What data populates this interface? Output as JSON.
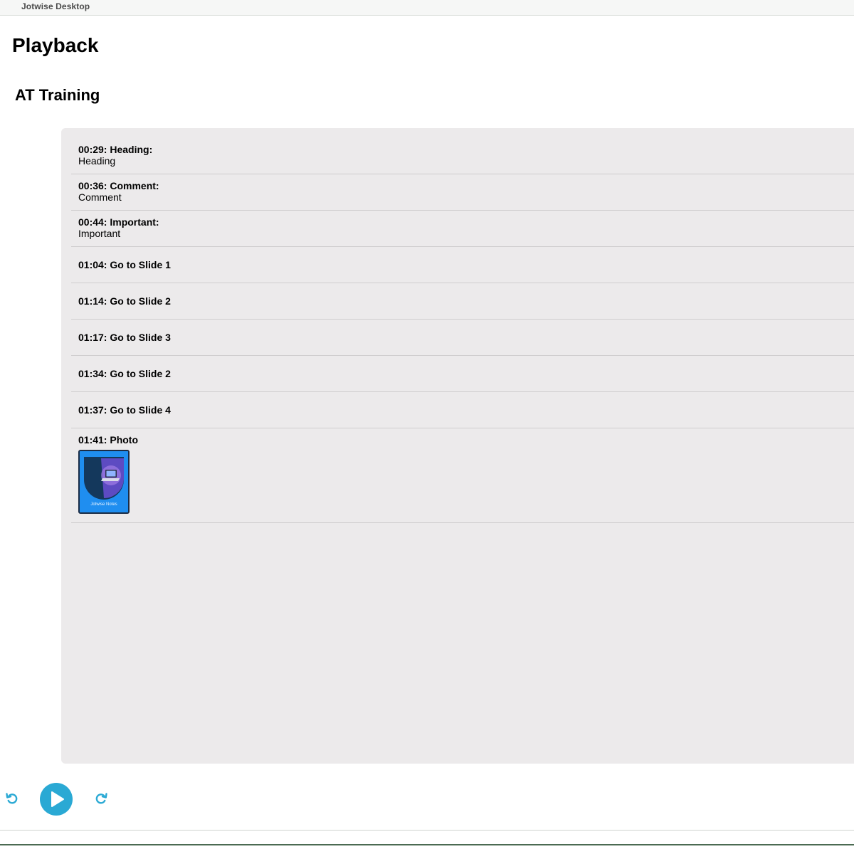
{
  "window": {
    "app_title": "Jotwise Desktop"
  },
  "page": {
    "title": "Playback",
    "recording_title": "AT Training"
  },
  "events": [
    {
      "title": "00:29: Heading:",
      "body": "Heading"
    },
    {
      "title": "00:36: Comment:",
      "body": "Comment"
    },
    {
      "title": "00:44: Important:",
      "body": "Important"
    },
    {
      "title": "01:04: Go to Slide 1",
      "body": ""
    },
    {
      "title": "01:14: Go to Slide 2",
      "body": ""
    },
    {
      "title": "01:17: Go to Slide 3",
      "body": ""
    },
    {
      "title": "01:34: Go to Slide 2",
      "body": ""
    },
    {
      "title": "01:37: Go to Slide 4",
      "body": ""
    },
    {
      "title": "01:41: Photo",
      "body": "",
      "photo_caption": "Jotwise Notes"
    }
  ],
  "controls": {
    "rewind_icon": "rotate-ccw-icon",
    "play_icon": "play-icon",
    "forward_icon": "rotate-cw-icon",
    "accent_color": "#2aa9d4"
  }
}
